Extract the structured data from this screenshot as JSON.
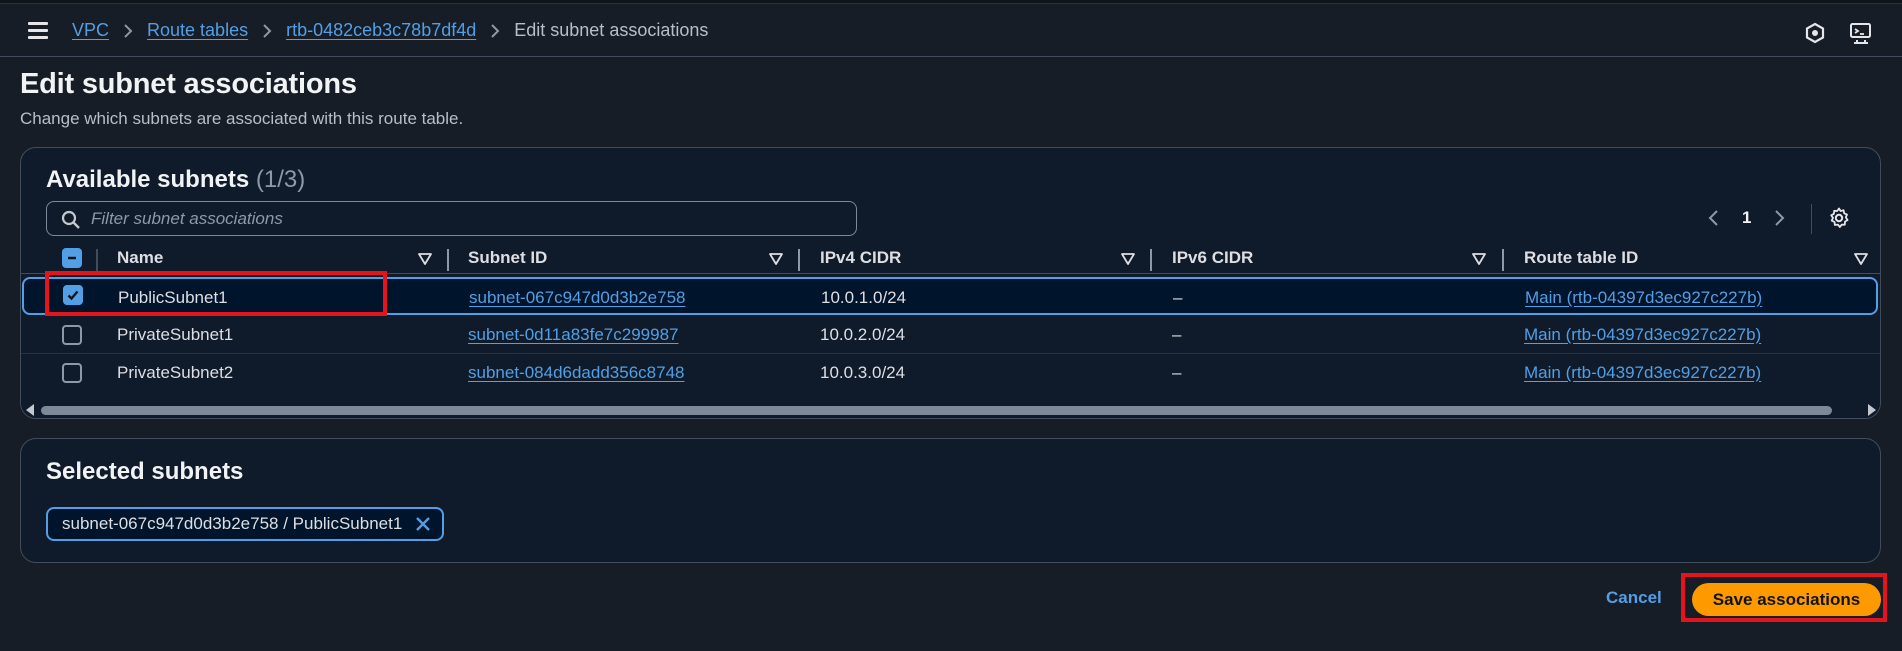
{
  "breadcrumb": {
    "items": [
      {
        "label": "VPC"
      },
      {
        "label": "Route tables"
      },
      {
        "label": "rtb-0482ceb3c78b7df4d"
      }
    ],
    "current": "Edit subnet associations"
  },
  "page": {
    "title": "Edit subnet associations",
    "description": "Change which subnets are associated with this route table."
  },
  "available": {
    "title": "Available subnets",
    "count": "(1/3)",
    "search_placeholder": "Filter subnet associations",
    "page_number": "1",
    "columns": [
      "Name",
      "Subnet ID",
      "IPv4 CIDR",
      "IPv6 CIDR",
      "Route table ID"
    ],
    "rows": [
      {
        "name": "PublicSubnet1",
        "subnet_id": "subnet-067c947d0d3b2e758",
        "ipv4": "10.0.1.0/24",
        "ipv6": "–",
        "route_table": "Main (rtb-04397d3ec927c227b)",
        "checked": true
      },
      {
        "name": "PrivateSubnet1",
        "subnet_id": "subnet-0d11a83fe7c299987",
        "ipv4": "10.0.2.0/24",
        "ipv6": "–",
        "route_table": "Main (rtb-04397d3ec927c227b)",
        "checked": false
      },
      {
        "name": "PrivateSubnet2",
        "subnet_id": "subnet-084d6dadd356c8748",
        "ipv4": "10.0.3.0/24",
        "ipv6": "–",
        "route_table": "Main (rtb-04397d3ec927c227b)",
        "checked": false
      }
    ]
  },
  "selected": {
    "title": "Selected subnets",
    "token": "subnet-067c947d0d3b2e758 / PublicSubnet1"
  },
  "footer": {
    "cancel_label": "Cancel",
    "save_label": "Save associations"
  },
  "colors": {
    "link": "#539fe5",
    "primary_button": "#ff9900",
    "highlight": "#e3141b",
    "background": "#161d26"
  },
  "icons": [
    "menu-icon",
    "chevron-right-icon",
    "cloudshell-icon",
    "feedback-icon",
    "search-icon",
    "sort-icon",
    "chevron-left-icon",
    "gear-icon",
    "close-icon"
  ]
}
